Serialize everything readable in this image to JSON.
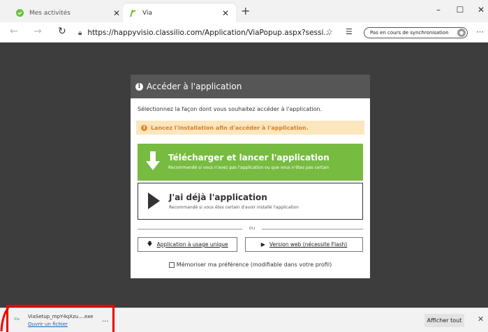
{
  "browser": {
    "tabs": [
      {
        "title": "Mes activités",
        "active": false
      },
      {
        "title": "Via",
        "active": true
      }
    ],
    "new_tab_glyph": "+",
    "window_controls": [
      "–",
      "☐",
      "✕"
    ],
    "url": "https://happyvisio.classilio.com/Application/ViaPopup.aspx?sessi...",
    "sync_label": "Pas en cours de synchronisation",
    "more_glyph": "⋯"
  },
  "modal": {
    "title": "Accéder à l'application",
    "instruction": "Sélectionnez la façon dont vous souhaitez accéder à l'application.",
    "warning": "Lancez l'installation afin d'accéder à l'application.",
    "download": {
      "title": "Télécharger et lancer l'application",
      "subtitle": "Recommandé si vous n'avez pas l'application ou que vous n'êtes pas certain"
    },
    "already": {
      "title": "J'ai déjà l'application",
      "subtitle": "Recommandé si vous êtes certain d'avoir installé l'application"
    },
    "divider_label": "ou",
    "single_use_label": "Application à usage unique",
    "web_version_label": "Version web (nécessite Flash)",
    "remember_label": "Mémoriser ma préférence (modifiable dans votre profil)",
    "remember_checked": false
  },
  "download_bar": {
    "file_name": "ViaSetup_mpY4qXzu....exe",
    "file_icon_text": "Via",
    "open_label": "Ouvrir un fichier",
    "more_glyph": "...",
    "show_all_label": "Afficher tout",
    "close_glyph": "✕"
  },
  "colors": {
    "overlay": "#3d3d3d",
    "modal_header": "#565656",
    "download_green": "#77bb41",
    "warning_bg": "#fbe6bd",
    "warning_text": "#d6812e",
    "highlight_red": "#ee0000"
  }
}
